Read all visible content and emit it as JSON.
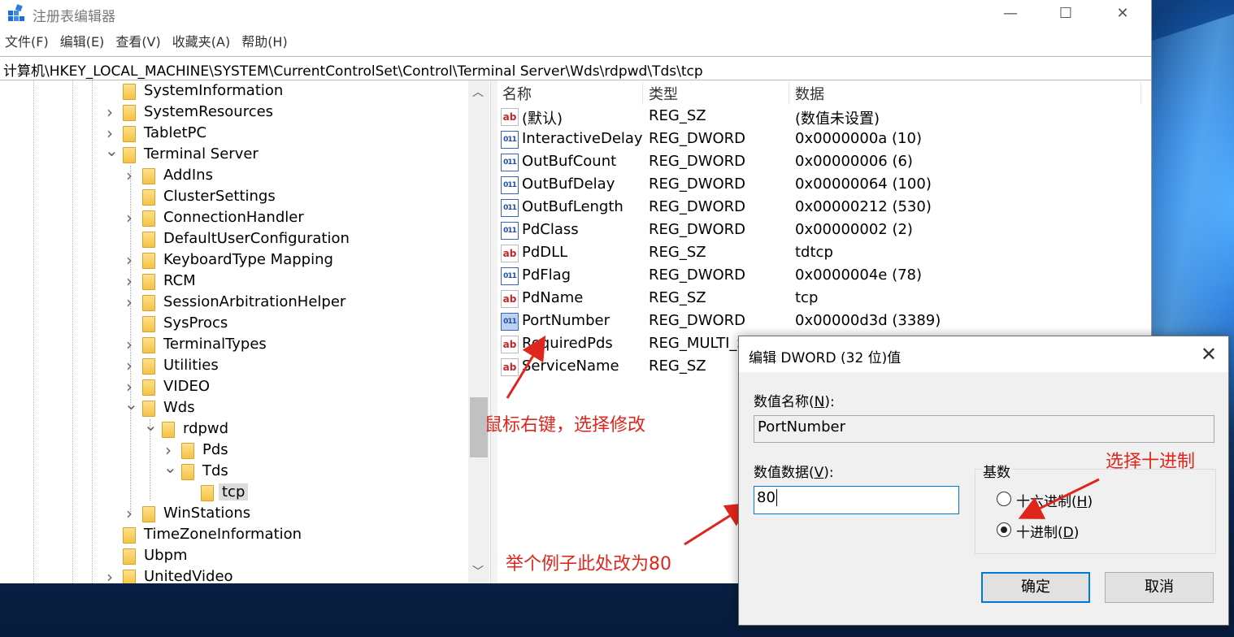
{
  "window": {
    "title": "注册表编辑器",
    "controls": [
      "—",
      "☐",
      "✕"
    ]
  },
  "menu": [
    "文件(F)",
    "编辑(E)",
    "查看(V)",
    "收藏夹(A)",
    "帮助(H)"
  ],
  "address": "计算机\\HKEY_LOCAL_MACHINE\\SYSTEM\\CurrentControlSet\\Control\\Terminal Server\\Wds\\rdpwd\\Tds\\tcp",
  "tree": [
    {
      "label": "SystemInformation",
      "expander": "",
      "depth": 0
    },
    {
      "label": "SystemResources",
      "expander": ">",
      "depth": 0
    },
    {
      "label": "TabletPC",
      "expander": ">",
      "depth": 0
    },
    {
      "label": "Terminal Server",
      "expander": "v",
      "depth": 0
    },
    {
      "label": "AddIns",
      "expander": ">",
      "depth": 1
    },
    {
      "label": "ClusterSettings",
      "expander": "",
      "depth": 1
    },
    {
      "label": "ConnectionHandler",
      "expander": ">",
      "depth": 1
    },
    {
      "label": "DefaultUserConfiguration",
      "expander": "",
      "depth": 1
    },
    {
      "label": "KeyboardType Mapping",
      "expander": ">",
      "depth": 1
    },
    {
      "label": "RCM",
      "expander": ">",
      "depth": 1
    },
    {
      "label": "SessionArbitrationHelper",
      "expander": ">",
      "depth": 1
    },
    {
      "label": "SysProcs",
      "expander": "",
      "depth": 1
    },
    {
      "label": "TerminalTypes",
      "expander": ">",
      "depth": 1
    },
    {
      "label": "Utilities",
      "expander": ">",
      "depth": 1
    },
    {
      "label": "VIDEO",
      "expander": ">",
      "depth": 1
    },
    {
      "label": "Wds",
      "expander": "v",
      "depth": 1
    },
    {
      "label": "rdpwd",
      "expander": "v",
      "depth": 2
    },
    {
      "label": "Pds",
      "expander": ">",
      "depth": 3
    },
    {
      "label": "Tds",
      "expander": "v",
      "depth": 3
    },
    {
      "label": "tcp",
      "expander": "",
      "depth": 4,
      "selected": true
    },
    {
      "label": "WinStations",
      "expander": ">",
      "depth": 1
    },
    {
      "label": "TimeZoneInformation",
      "expander": "",
      "depth": 0
    },
    {
      "label": "Ubpm",
      "expander": "",
      "depth": 0
    },
    {
      "label": "UnitedVideo",
      "expander": ">",
      "depth": 0
    }
  ],
  "list": {
    "headers": {
      "name": "名称",
      "type": "类型",
      "data": "数据"
    },
    "rows": [
      {
        "icon": "ab",
        "name": "(默认)",
        "type": "REG_SZ",
        "data": "(数值未设置)"
      },
      {
        "icon": "bin",
        "name": "InteractiveDelay",
        "type": "REG_DWORD",
        "data": "0x0000000a (10)"
      },
      {
        "icon": "bin",
        "name": "OutBufCount",
        "type": "REG_DWORD",
        "data": "0x00000006 (6)"
      },
      {
        "icon": "bin",
        "name": "OutBufDelay",
        "type": "REG_DWORD",
        "data": "0x00000064 (100)"
      },
      {
        "icon": "bin",
        "name": "OutBufLength",
        "type": "REG_DWORD",
        "data": "0x00000212 (530)"
      },
      {
        "icon": "bin",
        "name": "PdClass",
        "type": "REG_DWORD",
        "data": "0x00000002 (2)"
      },
      {
        "icon": "ab",
        "name": "PdDLL",
        "type": "REG_SZ",
        "data": "tdtcp"
      },
      {
        "icon": "bin",
        "name": "PdFlag",
        "type": "REG_DWORD",
        "data": "0x0000004e (78)"
      },
      {
        "icon": "ab",
        "name": "PdName",
        "type": "REG_SZ",
        "data": "tcp"
      },
      {
        "icon": "bin",
        "name": "PortNumber",
        "type": "REG_DWORD",
        "data": "0x00000d3d (3389)",
        "highlight": true
      },
      {
        "icon": "ab",
        "name": "RequiredPds",
        "type": "REG_MULTI_SZ",
        "data": ""
      },
      {
        "icon": "ab",
        "name": "ServiceName",
        "type": "REG_SZ",
        "data": ""
      }
    ]
  },
  "dialog": {
    "title": "编辑 DWORD (32 位)值",
    "close": "✕",
    "name_label_prefix": "数值名称(",
    "name_label_key": "N",
    "name_label_suffix": "):",
    "name_value": "PortNumber",
    "data_label_prefix": "数值数据(",
    "data_label_key": "V",
    "data_label_suffix": "):",
    "data_value": "80",
    "radix_label": "基数",
    "hex_label_prefix": "十六进制(",
    "hex_label_key": "H",
    "hex_label_suffix": ")",
    "dec_label_prefix": "十进制(",
    "dec_label_key": "D",
    "dec_label_suffix": ")",
    "radix_selected": "decimal",
    "ok": "确定",
    "cancel": "取消"
  },
  "annotations": {
    "right_click": "鼠标右键，选择修改",
    "example": "举个例子此处改为80",
    "choose_decimal": "选择十进制"
  },
  "colors": {
    "annotation": "#e0261c",
    "focus_border": "#0078d7",
    "folder": "#f5c343"
  }
}
